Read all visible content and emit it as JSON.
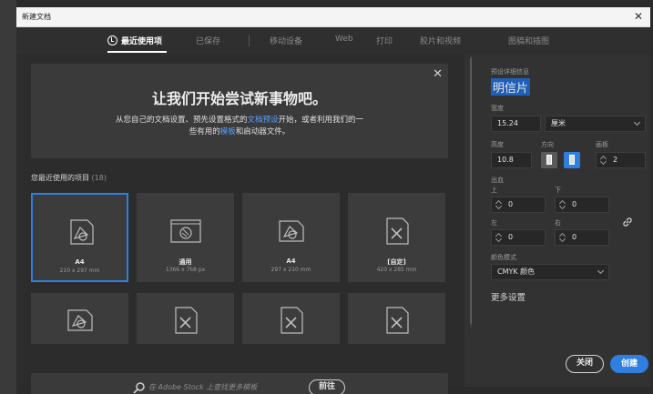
{
  "window": {
    "title": "新建文档"
  },
  "tabs": [
    {
      "label": "最近使用项"
    },
    {
      "label": "已保存"
    },
    {
      "label": "移动设备"
    },
    {
      "label": "Web"
    },
    {
      "label": "打印"
    },
    {
      "label": "胶片和视频"
    },
    {
      "label": "图稿和插图"
    }
  ],
  "welcome": {
    "headline": "让我们开始尝试新事物吧。",
    "desc_part1": "从您自己的文档设置、预先设置格式的",
    "desc_link1": "文档预设",
    "desc_part2": "开始，或者利用我们的一",
    "desc_part3": "些有用的",
    "desc_link2": "模板",
    "desc_part4": "和启动器文件。"
  },
  "recent": {
    "label": "您最近使用的项目",
    "count": "(18)",
    "items": [
      {
        "name": "A4",
        "size": "210 x 297 mm"
      },
      {
        "name": "通用",
        "size": "1366 x 768 px"
      },
      {
        "name": "A4",
        "size": "297 x 210 mm"
      },
      {
        "name": "[自定]",
        "size": "420 x 285 mm"
      }
    ]
  },
  "search": {
    "placeholder": "在 Adobe Stock 上查找更多模板",
    "go_label": "前往"
  },
  "panel": {
    "section_label": "预设详细信息",
    "preset_name": "明信片",
    "width_label": "宽度",
    "width_value": "15.24",
    "unit_value": "厘米",
    "height_label": "高度",
    "height_value": "10.8",
    "orientation_label": "方向",
    "artboards_label": "画板",
    "artboards_value": "2",
    "bleed_label": "出血",
    "top_label": "上",
    "top_value": "0",
    "bottom_label": "下",
    "bottom_value": "0",
    "left_label": "左",
    "left_value": "0",
    "right_label": "右",
    "right_value": "0",
    "color_mode_label": "颜色模式",
    "color_mode_value": "CMYK 颜色",
    "more_settings": "更多设置",
    "close_button": "关闭",
    "create_button": "创建"
  },
  "colors": {
    "accent": "#2f7fe0",
    "link": "#5aa0ff"
  }
}
